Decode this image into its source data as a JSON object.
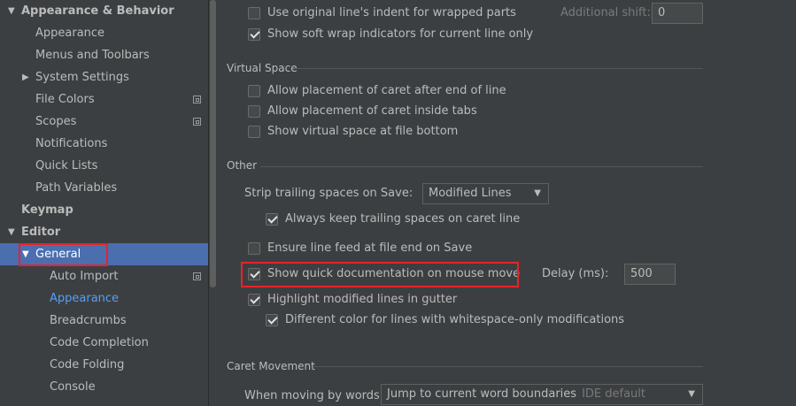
{
  "sidebar": {
    "items": [
      {
        "label": "Appearance & Behavior"
      },
      {
        "label": "Appearance"
      },
      {
        "label": "Menus and Toolbars"
      },
      {
        "label": "System Settings"
      },
      {
        "label": "File Colors"
      },
      {
        "label": "Scopes"
      },
      {
        "label": "Notifications"
      },
      {
        "label": "Quick Lists"
      },
      {
        "label": "Path Variables"
      },
      {
        "label": "Keymap"
      },
      {
        "label": "Editor"
      },
      {
        "label": "General"
      },
      {
        "label": "Auto Import"
      },
      {
        "label": "Appearance"
      },
      {
        "label": "Breadcrumbs"
      },
      {
        "label": "Code Completion"
      },
      {
        "label": "Code Folding"
      },
      {
        "label": "Console"
      }
    ]
  },
  "softwrap": {
    "use_original_indent": "Use original line's indent for wrapped parts",
    "additional_shift_label": "Additional shift:",
    "additional_shift_value": "0",
    "show_indicators": "Show soft wrap indicators for current line only"
  },
  "virtual_space": {
    "title": "Virtual Space",
    "after_end_of_line": "Allow placement of caret after end of line",
    "inside_tabs": "Allow placement of caret inside tabs",
    "file_bottom": "Show virtual space at file bottom"
  },
  "other": {
    "title": "Other",
    "strip_label": "Strip trailing spaces on Save:",
    "strip_value": "Modified Lines",
    "keep_trailing": "Always keep trailing spaces on caret line",
    "ensure_line_feed": "Ensure line feed at file end on Save",
    "quick_doc": "Show quick documentation on mouse move",
    "delay_label": "Delay (ms):",
    "delay_value": "500",
    "highlight_modified": "Highlight modified lines in gutter",
    "different_color": "Different color for lines with whitespace-only modifications"
  },
  "caret_movement": {
    "title": "Caret Movement",
    "words_label": "When moving by words:",
    "words_value": "Jump to current word boundaries",
    "words_hint": "IDE default"
  },
  "colors": {
    "selection": "#4b6eaf",
    "link": "#589df6",
    "highlight_box": "#e8232a"
  }
}
